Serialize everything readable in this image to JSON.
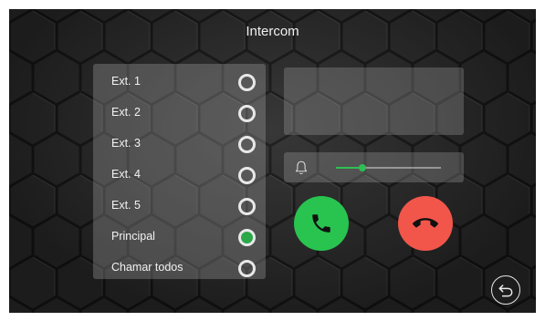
{
  "screen": {
    "title": "Intercom"
  },
  "extensions": [
    {
      "label": "Ext. 1",
      "selected": false
    },
    {
      "label": "Ext. 2",
      "selected": false
    },
    {
      "label": "Ext. 3",
      "selected": false
    },
    {
      "label": "Ext. 4",
      "selected": false
    },
    {
      "label": "Ext. 5",
      "selected": false
    },
    {
      "label": "Principal",
      "selected": true
    },
    {
      "label": "Chamar todos",
      "selected": false
    }
  ],
  "volume": {
    "icon": "bell-icon",
    "level": 0.25
  },
  "actions": {
    "answer": {
      "icon": "phone-answer-icon",
      "color": "#28c44f"
    },
    "hangup": {
      "icon": "phone-hangup-icon",
      "color": "#f2564a"
    },
    "back": {
      "icon": "back-arrow-icon"
    }
  },
  "colors": {
    "accent": "#2fbf55",
    "selected_radio": "#2aa84a"
  }
}
